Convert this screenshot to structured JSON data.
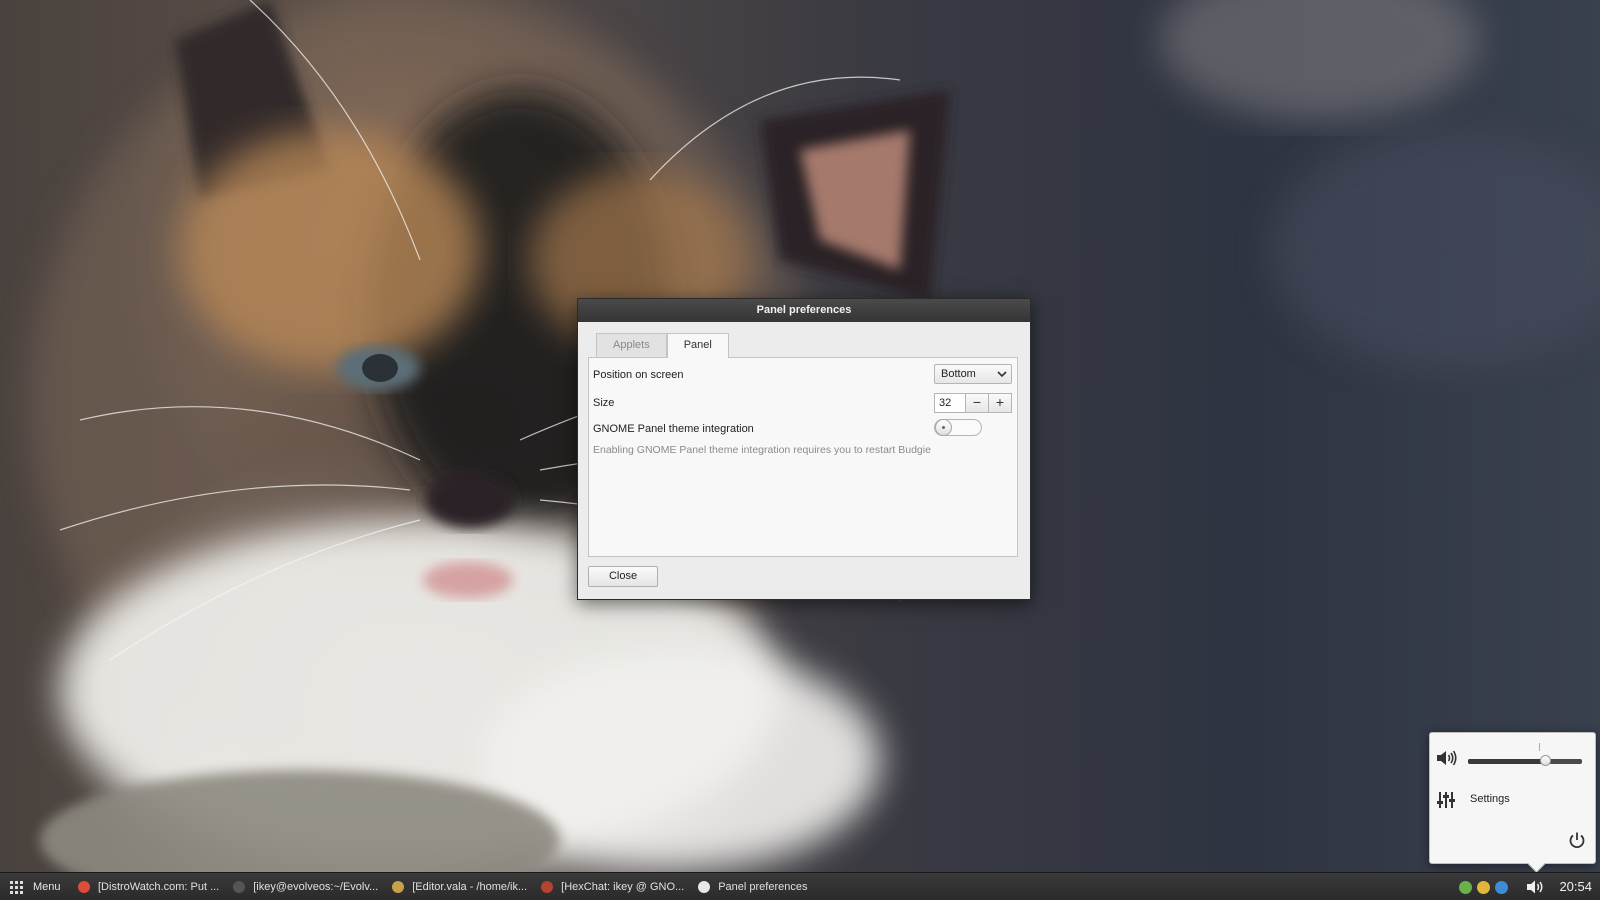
{
  "dialog": {
    "title": "Panel preferences",
    "tabs": [
      {
        "label": "Applets",
        "active": false
      },
      {
        "label": "Panel",
        "active": true
      }
    ],
    "position": {
      "label": "Position on screen",
      "value": "Bottom"
    },
    "size": {
      "label": "Size",
      "value": "32",
      "minus": "−",
      "plus": "+"
    },
    "theme_integration": {
      "label": "GNOME Panel theme integration",
      "enabled": false
    },
    "hint": "Enabling GNOME Panel theme integration requires you to restart Budgie",
    "close_label": "Close"
  },
  "sound_popover": {
    "volume_fraction": 0.68,
    "settings_label": "Settings",
    "icons": [
      "speaker-icon",
      "mixer-settings-icon",
      "power-icon"
    ]
  },
  "taskbar": {
    "menu_label": "Menu",
    "tasks": [
      {
        "label": "[DistroWatch.com: Put ...",
        "icon": "chrome-icon",
        "color": "#dd4b39"
      },
      {
        "label": "[ikey@evolveos:~/Evolv...",
        "icon": "terminal-icon",
        "color": "#555555"
      },
      {
        "label": "[Editor.vala - /home/ik...",
        "icon": "editor-icon",
        "color": "#c8a24a"
      },
      {
        "label": "[HexChat: ikey @ GNO...",
        "icon": "hexchat-icon",
        "color": "#b5432f"
      },
      {
        "label": "Panel preferences",
        "icon": "preferences-icon",
        "color": "#e8e8e8"
      }
    ],
    "tray_icons": [
      {
        "name": "network-icon",
        "color": "#6ab04c"
      },
      {
        "name": "chrome-tray-icon",
        "color": "#e0b73a"
      },
      {
        "name": "updates-icon",
        "color": "#3c8dd6"
      }
    ],
    "clock": "20:54"
  },
  "colors": {
    "titlebar": "#3f3f3f",
    "dialog_bg": "#ececec",
    "taskbar_bg": "#2f2f2f"
  }
}
